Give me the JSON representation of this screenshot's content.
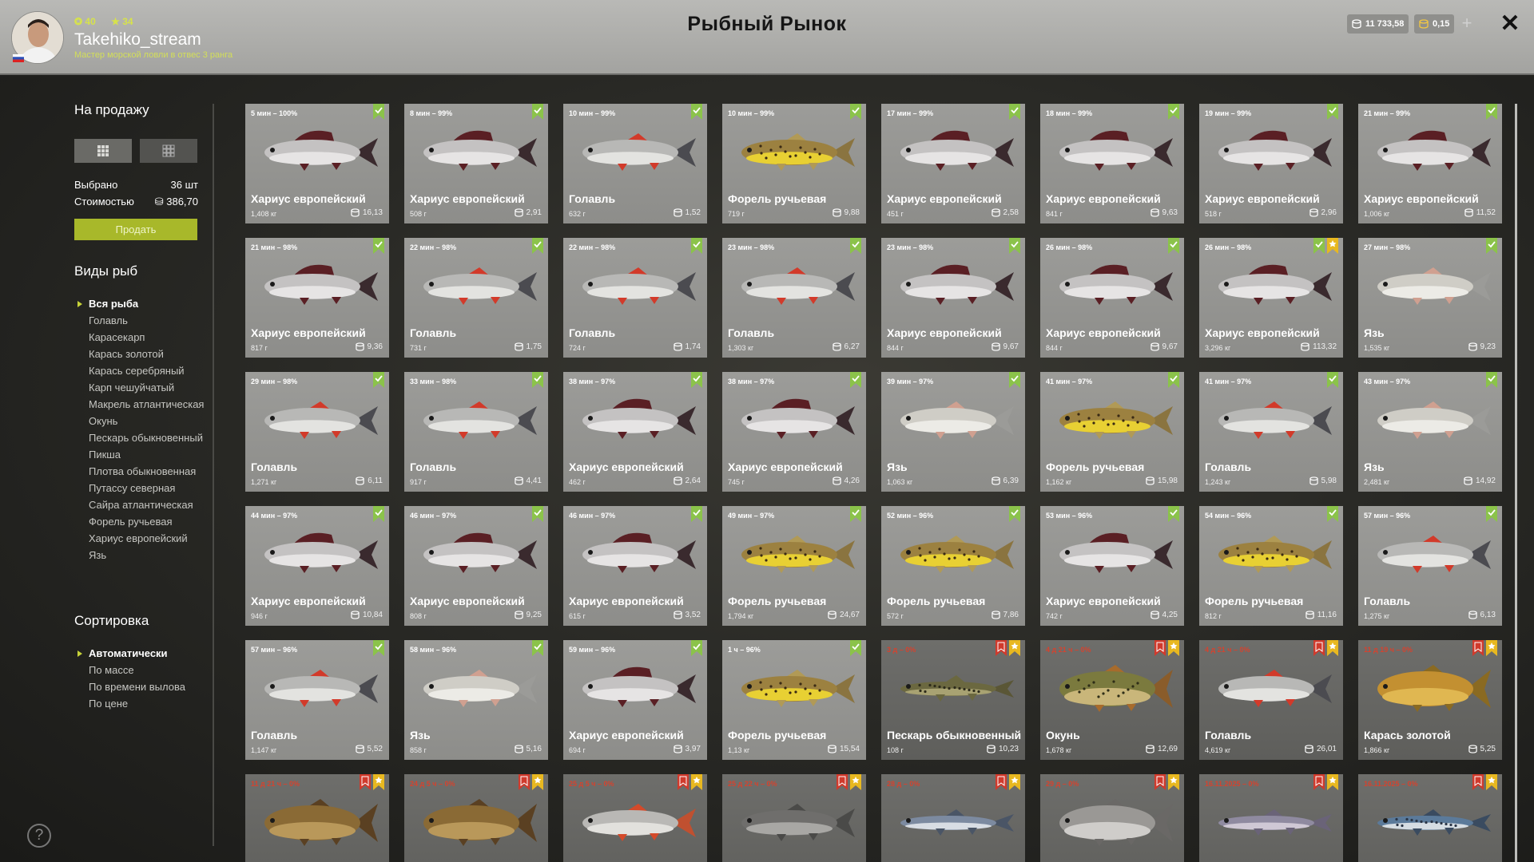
{
  "header": {
    "title": "Рыбный Рынок",
    "stat_level": "40",
    "stat_stars": "34",
    "username": "Takehiko_stream",
    "rank": "Мастер морской ловли в отвес 3 ранга",
    "silver": "11 733,58",
    "gold": "0,15",
    "plus": "+",
    "close": "✕"
  },
  "sidebar": {
    "for_sale_title": "На продажу",
    "selected_label": "Выбрано",
    "selected_value": "36 шт",
    "cost_label": "Стоимостью",
    "cost_value": "386,70",
    "sell_button": "Продать",
    "species_title": "Виды рыб",
    "species": [
      "Вся рыба",
      "Голавль",
      "Карасекарп",
      "Карась золотой",
      "Карась серебряный",
      "Карп чешуйчатый",
      "Макрель атлантическая",
      "Окунь",
      "Пескарь обыкновенный",
      "Пикша",
      "Плотва обыкновенная",
      "Путассу северная",
      "Сайра атлантическая",
      "Форель ручьевая",
      "Хариус европейский",
      "Язь"
    ],
    "sort_title": "Сортировка",
    "sort_options": [
      "Автоматически",
      "По массе",
      "По времени вылова",
      "По цене"
    ],
    "help": "?"
  },
  "colors": {
    "accent": "#a8b82a",
    "badge_green": "#8bc34a",
    "badge_red": "#d03a2c",
    "badge_yellow": "#e8b820"
  },
  "cards": [
    {
      "time": "5 мин – 100%",
      "name": "Хариус европейский",
      "weight": "1,408 кг",
      "price": "16,13",
      "fish": "grayling",
      "state": "ok"
    },
    {
      "time": "8 мин – 99%",
      "name": "Хариус европейский",
      "weight": "508 г",
      "price": "2,91",
      "fish": "grayling",
      "state": "ok"
    },
    {
      "time": "10 мин – 99%",
      "name": "Голавль",
      "weight": "632 г",
      "price": "1,52",
      "fish": "chub",
      "state": "ok"
    },
    {
      "time": "10 мин – 99%",
      "name": "Форель ручьевая",
      "weight": "719 г",
      "price": "9,88",
      "fish": "trout",
      "state": "ok"
    },
    {
      "time": "17 мин – 99%",
      "name": "Хариус европейский",
      "weight": "451 г",
      "price": "2,58",
      "fish": "grayling",
      "state": "ok"
    },
    {
      "time": "18 мин – 99%",
      "name": "Хариус европейский",
      "weight": "841 г",
      "price": "9,63",
      "fish": "grayling",
      "state": "ok"
    },
    {
      "time": "19 мин – 99%",
      "name": "Хариус европейский",
      "weight": "518 г",
      "price": "2,96",
      "fish": "grayling",
      "state": "ok"
    },
    {
      "time": "21 мин – 99%",
      "name": "Хариус европейский",
      "weight": "1,006 кг",
      "price": "11,52",
      "fish": "grayling",
      "state": "ok"
    },
    {
      "time": "21 мин – 98%",
      "name": "Хариус европейский",
      "weight": "817 г",
      "price": "9,36",
      "fish": "grayling",
      "state": "ok"
    },
    {
      "time": "22 мин – 98%",
      "name": "Голавль",
      "weight": "731 г",
      "price": "1,75",
      "fish": "chub",
      "state": "ok"
    },
    {
      "time": "22 мин – 98%",
      "name": "Голавль",
      "weight": "724 г",
      "price": "1,74",
      "fish": "chub",
      "state": "ok"
    },
    {
      "time": "23 мин – 98%",
      "name": "Голавль",
      "weight": "1,303 кг",
      "price": "6,27",
      "fish": "chub",
      "state": "ok"
    },
    {
      "time": "23 мин – 98%",
      "name": "Хариус европейский",
      "weight": "844 г",
      "price": "9,67",
      "fish": "grayling",
      "state": "ok"
    },
    {
      "time": "26 мин – 98%",
      "name": "Хариус европейский",
      "weight": "844 г",
      "price": "9,67",
      "fish": "grayling",
      "state": "ok"
    },
    {
      "time": "26 мин – 98%",
      "name": "Хариус европейский",
      "weight": "3,296 кг",
      "price": "113,32",
      "fish": "grayling",
      "state": "okstar"
    },
    {
      "time": "27 мин – 98%",
      "name": "Язь",
      "weight": "1,535 кг",
      "price": "9,23",
      "fish": "ide",
      "state": "ok"
    },
    {
      "time": "29 мин – 98%",
      "name": "Голавль",
      "weight": "1,271 кг",
      "price": "6,11",
      "fish": "chub",
      "state": "ok"
    },
    {
      "time": "33 мин – 98%",
      "name": "Голавль",
      "weight": "917 г",
      "price": "4,41",
      "fish": "chub",
      "state": "ok"
    },
    {
      "time": "38 мин – 97%",
      "name": "Хариус европейский",
      "weight": "462 г",
      "price": "2,64",
      "fish": "grayling",
      "state": "ok"
    },
    {
      "time": "38 мин – 97%",
      "name": "Хариус европейский",
      "weight": "745 г",
      "price": "4,26",
      "fish": "grayling",
      "state": "ok"
    },
    {
      "time": "39 мин – 97%",
      "name": "Язь",
      "weight": "1,063 кг",
      "price": "6,39",
      "fish": "ide",
      "state": "ok"
    },
    {
      "time": "41 мин – 97%",
      "name": "Форель ручьевая",
      "weight": "1,162 кг",
      "price": "15,98",
      "fish": "trout",
      "state": "ok"
    },
    {
      "time": "41 мин – 97%",
      "name": "Голавль",
      "weight": "1,243 кг",
      "price": "5,98",
      "fish": "chub",
      "state": "ok"
    },
    {
      "time": "43 мин – 97%",
      "name": "Язь",
      "weight": "2,481 кг",
      "price": "14,92",
      "fish": "ide",
      "state": "ok"
    },
    {
      "time": "44 мин – 97%",
      "name": "Хариус европейский",
      "weight": "946 г",
      "price": "10,84",
      "fish": "grayling",
      "state": "ok"
    },
    {
      "time": "46 мин – 97%",
      "name": "Хариус европейский",
      "weight": "808 г",
      "price": "9,25",
      "fish": "grayling",
      "state": "ok"
    },
    {
      "time": "46 мин – 97%",
      "name": "Хариус европейский",
      "weight": "615 г",
      "price": "3,52",
      "fish": "grayling",
      "state": "ok"
    },
    {
      "time": "49 мин – 97%",
      "name": "Форель ручьевая",
      "weight": "1,794 кг",
      "price": "24,67",
      "fish": "trout",
      "state": "ok"
    },
    {
      "time": "52 мин – 96%",
      "name": "Форель ручьевая",
      "weight": "572 г",
      "price": "7,86",
      "fish": "trout",
      "state": "ok"
    },
    {
      "time": "53 мин – 96%",
      "name": "Хариус европейский",
      "weight": "742 г",
      "price": "4,25",
      "fish": "grayling",
      "state": "ok"
    },
    {
      "time": "54 мин – 96%",
      "name": "Форель ручьевая",
      "weight": "812 г",
      "price": "11,16",
      "fish": "trout",
      "state": "ok"
    },
    {
      "time": "57 мин – 96%",
      "name": "Голавль",
      "weight": "1,275 кг",
      "price": "6,13",
      "fish": "chub",
      "state": "ok"
    },
    {
      "time": "57 мин – 96%",
      "name": "Голавль",
      "weight": "1,147 кг",
      "price": "5,52",
      "fish": "chub",
      "state": "ok"
    },
    {
      "time": "58 мин – 96%",
      "name": "Язь",
      "weight": "858 г",
      "price": "5,16",
      "fish": "ide",
      "state": "ok"
    },
    {
      "time": "59 мин – 96%",
      "name": "Хариус европейский",
      "weight": "694 г",
      "price": "3,97",
      "fish": "grayling",
      "state": "ok"
    },
    {
      "time": "1 ч – 96%",
      "name": "Форель ручьевая",
      "weight": "1,13 кг",
      "price": "15,54",
      "fish": "trout",
      "state": "ok"
    },
    {
      "time": "3 д – 0%",
      "name": "Пескарь обыкновенный",
      "weight": "108 г",
      "price": "10,23",
      "fish": "gudgeon",
      "state": "spoiled"
    },
    {
      "time": "4 д 21 ч – 0%",
      "name": "Окунь",
      "weight": "1,678 кг",
      "price": "12,69",
      "fish": "perch",
      "state": "spoiled"
    },
    {
      "time": "4 д 21 ч – 0%",
      "name": "Голавль",
      "weight": "4,619 кг",
      "price": "26,01",
      "fish": "chub",
      "state": "spoiled"
    },
    {
      "time": "11 д 19 ч – 0%",
      "name": "Карась золотой",
      "weight": "1,866 кг",
      "price": "5,25",
      "fish": "crucian",
      "state": "spoiled"
    },
    {
      "time": "11 д 21 ч – 0%",
      "name": "",
      "weight": "",
      "price": "",
      "fish": "carp",
      "state": "spoiled"
    },
    {
      "time": "24 д 5 ч – 0%",
      "name": "",
      "weight": "",
      "price": "",
      "fish": "carp",
      "state": "spoiled"
    },
    {
      "time": "25 д 5 ч – 0%",
      "name": "",
      "weight": "",
      "price": "",
      "fish": "roach",
      "state": "spoiled"
    },
    {
      "time": "25 д 22 ч – 0%",
      "name": "",
      "weight": "",
      "price": "",
      "fish": "haddock",
      "state": "spoiled"
    },
    {
      "time": "28 д – 0%",
      "name": "",
      "weight": "",
      "price": "",
      "fish": "saury",
      "state": "spoiled"
    },
    {
      "time": "29 д – 0%",
      "name": "",
      "weight": "",
      "price": "",
      "fish": "crucian_silver",
      "state": "spoiled"
    },
    {
      "time": "16.11.2025 – 0%",
      "name": "",
      "weight": "",
      "price": "",
      "fish": "whiting",
      "state": "spoiled"
    },
    {
      "time": "16.11.2025 – 0%",
      "name": "",
      "weight": "",
      "price": "",
      "fish": "mackerel",
      "state": "spoiled"
    }
  ]
}
